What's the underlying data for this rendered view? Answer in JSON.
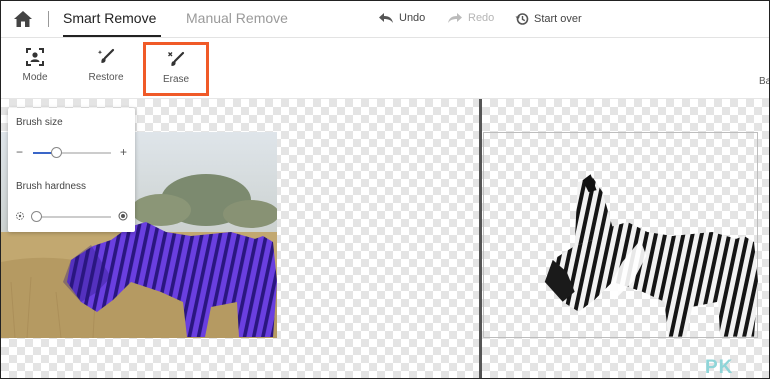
{
  "nav": {
    "tabs": [
      {
        "label": "Smart Remove",
        "active": true
      },
      {
        "label": "Manual Remove",
        "active": false
      }
    ],
    "actions": {
      "undo": "Undo",
      "redo": "Redo",
      "start_over": "Start over"
    }
  },
  "toolbar": {
    "tools": [
      {
        "label": "Mode",
        "icon": "person-frame-icon"
      },
      {
        "label": "Restore",
        "icon": "restore-brush-icon"
      },
      {
        "label": "Erase",
        "icon": "erase-brush-icon",
        "active": true
      }
    ],
    "right_label": "Ba"
  },
  "brush_panel": {
    "size_label": "Brush size",
    "hardness_label": "Brush hardness",
    "size_value": 0.3,
    "hardness_value": 0.05
  },
  "watermark": "PK",
  "colors": {
    "accent_outline": "#f05a28",
    "slider": "#3a66c8",
    "mask_overlay": "#5b2fd0",
    "watermark": "#8fd5d8"
  }
}
